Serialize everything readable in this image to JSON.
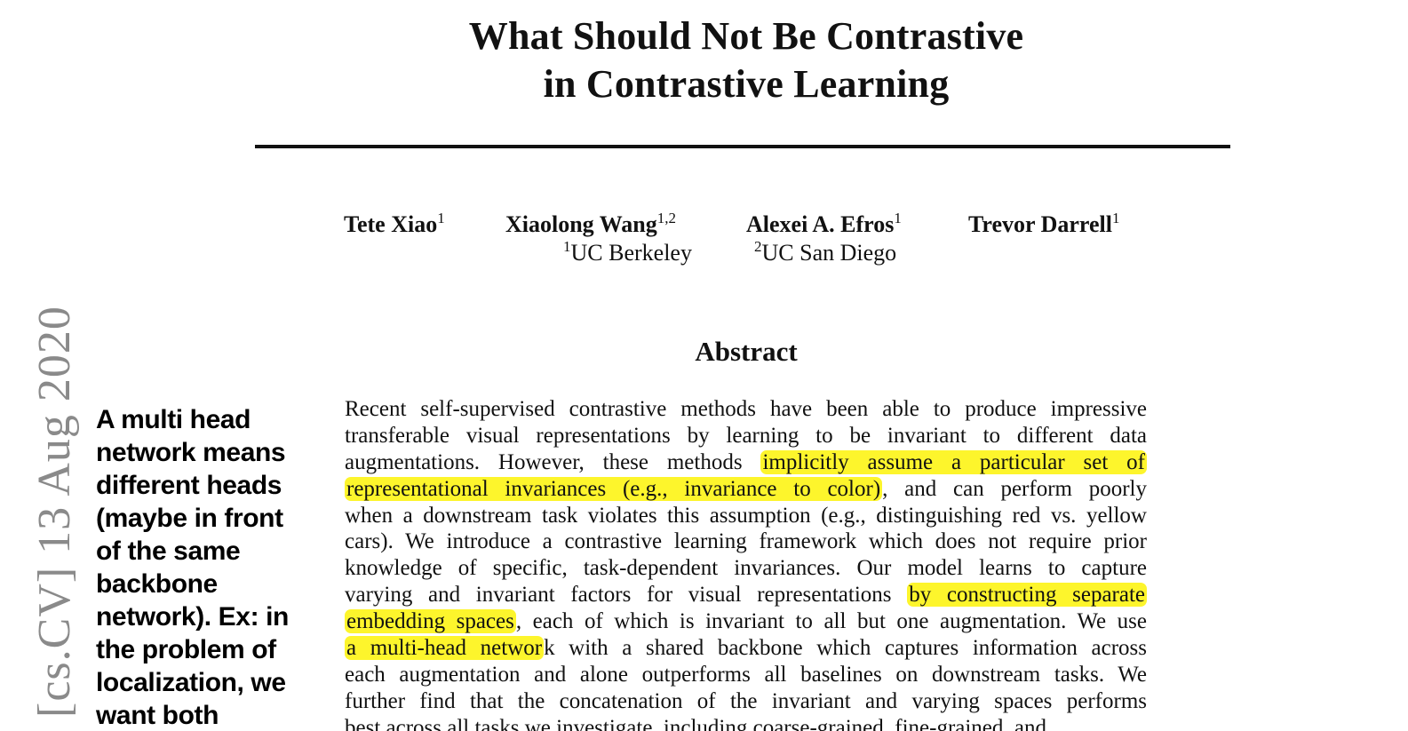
{
  "title": {
    "line1": "What Should Not Be Contrastive",
    "line2": "in Contrastive Learning"
  },
  "authors": [
    {
      "name": "Tete Xiao",
      "sup": "1"
    },
    {
      "name": "Xiaolong Wang",
      "sup": "1,2"
    },
    {
      "name": "Alexei A. Efros",
      "sup": "1"
    },
    {
      "name": "Trevor Darrell",
      "sup": "1"
    }
  ],
  "affiliations": [
    {
      "sup": "1",
      "name": "UC Berkeley"
    },
    {
      "sup": "2",
      "name": "UC San Diego"
    }
  ],
  "abstract": {
    "heading": "Abstract",
    "lines": [
      [
        {
          "t": "Recent self-supervised contrastive methods have been able to produce impressive"
        }
      ],
      [
        {
          "t": "transferable visual representations by learning to be invariant to different data"
        }
      ],
      [
        {
          "t": "augmentations.  However, these methods "
        },
        {
          "t": "implicitly assume a particular set of",
          "hl": true
        }
      ],
      [
        {
          "t": "representational invariances (e.g., invariance to color)",
          "hl": true
        },
        {
          "t": ", and can perform poorly"
        }
      ],
      [
        {
          "t": "when a downstream task violates this assumption (e.g., distinguishing red vs. yellow"
        }
      ],
      [
        {
          "t": "cars). We introduce a contrastive learning framework which does not require prior"
        }
      ],
      [
        {
          "t": "knowledge of specific, task-dependent invariances. Our model learns to capture"
        }
      ],
      [
        {
          "t": "varying and invariant factors for visual representations "
        },
        {
          "t": "by constructing separate",
          "hl": true
        }
      ],
      [
        {
          "t": "embedding spaces",
          "hl": true
        },
        {
          "t": ", each of which is invariant to all but one augmentation. We use"
        }
      ],
      [
        {
          "t": "a multi-head networ",
          "hl": true
        },
        {
          "t": "k with a shared backbone which captures information across"
        }
      ],
      [
        {
          "t": "each augmentation and alone outperforms all baselines on downstream tasks. We"
        }
      ],
      [
        {
          "t": "further find that the concatenation of the invariant and varying spaces performs"
        }
      ],
      [
        {
          "t": "best across all tasks we investigate, including coarse-grained, fine-grained, and"
        }
      ]
    ]
  },
  "arxiv_stamp": "[cs.CV]  13 Aug 2020",
  "annotation": {
    "lines": [
      "A multi head",
      "network means",
      "different heads",
      "(maybe in front",
      "of the same",
      "backbone",
      "network). Ex: in",
      "the problem of",
      "localization, we",
      "want both"
    ]
  },
  "colors": {
    "highlight": "#fdf52c",
    "text": "#111111",
    "stamp": "#8a8a8a"
  }
}
